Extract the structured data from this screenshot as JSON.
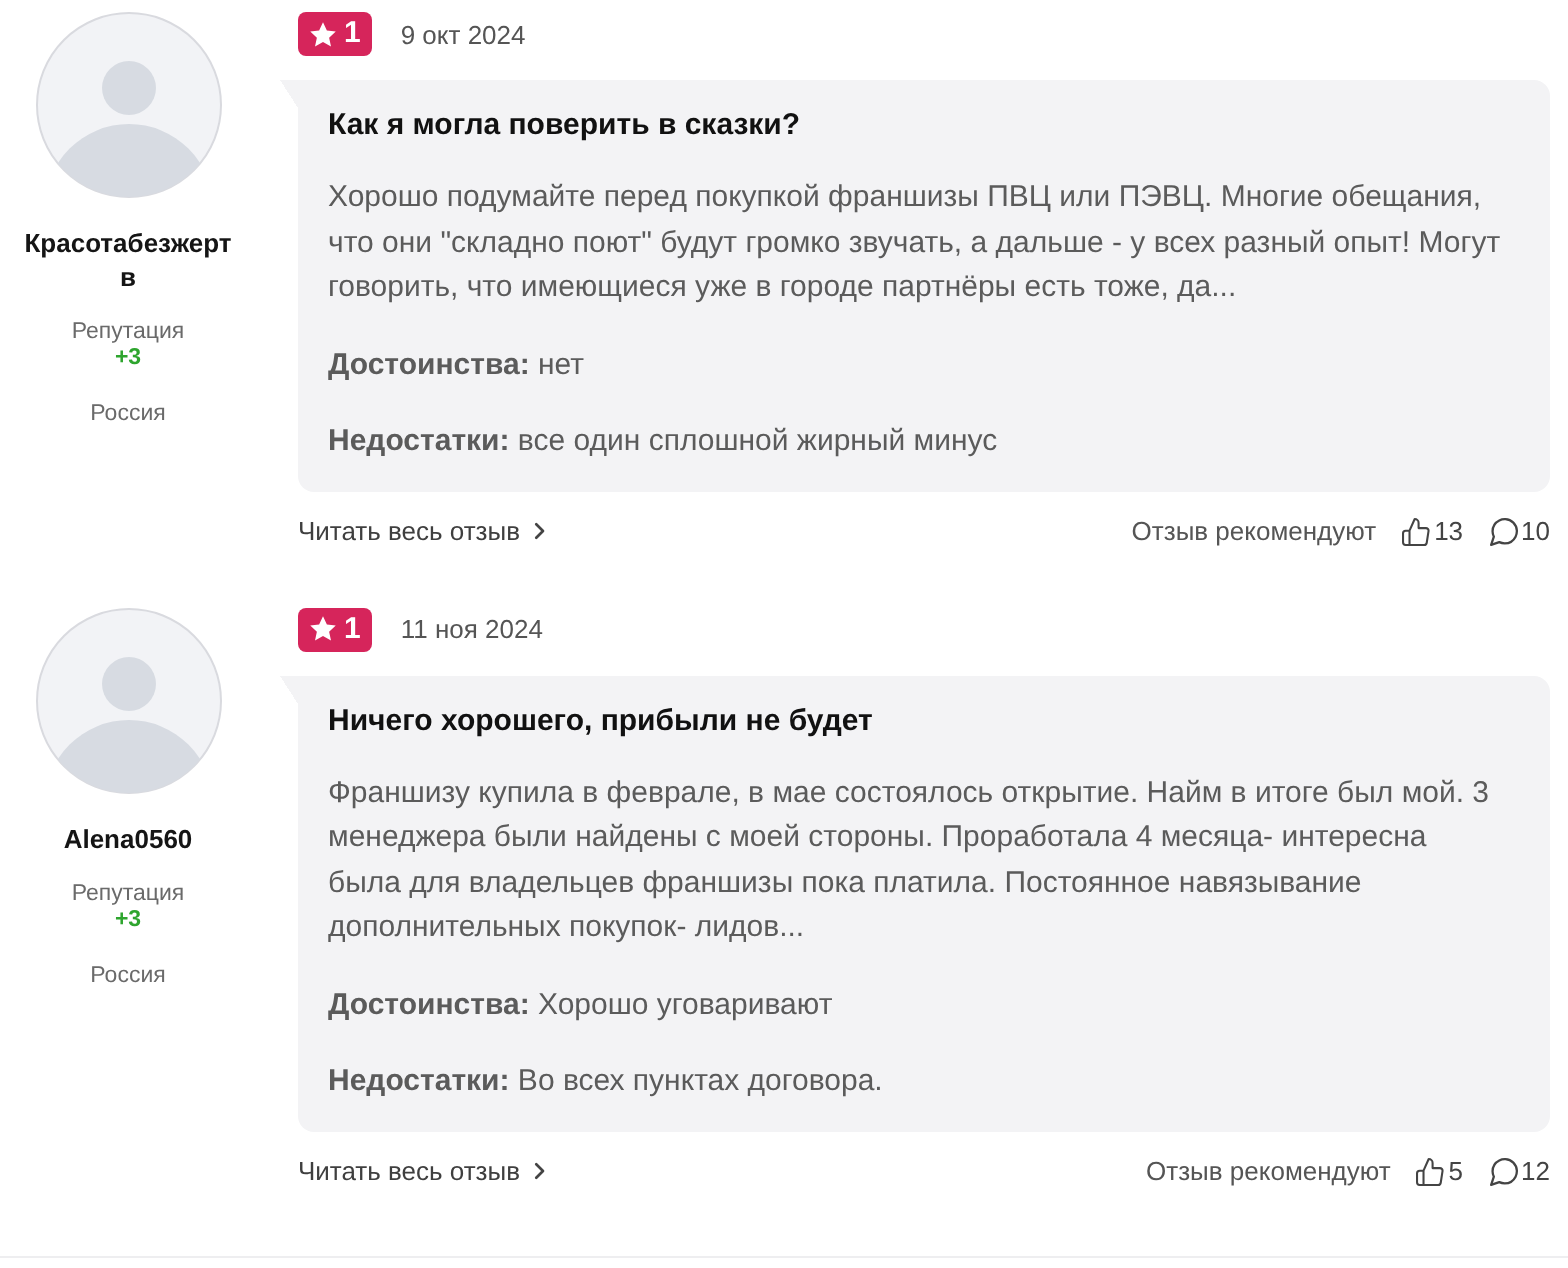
{
  "reviews": [
    {
      "author": {
        "name": "Красотабезжертв",
        "reputation_label": "Репутация",
        "reputation": "+3",
        "country": "Россия"
      },
      "rating": "1",
      "date": "9 окт 2024",
      "title": "Как я могла поверить в сказки?",
      "text": "Хорошо подумайте перед покупкой франшизы ПВЦ или ПЭВЦ. Многие обещания, что они \"складно поют\" будут громко звучать, а дальше - у всех разный опыт! Могут говорить, что имеющиеся уже в городе партнёры есть тоже, да...",
      "pros": "**Достоинства:** нет",
      "cons": "**Недостатки:** все один сплошной жирный минус",
      "read_more": "Читать весь отзыв",
      "recommend_label": "Отзыв рекомендуют",
      "likes": "13",
      "comments": "10"
    },
    {
      "author": {
        "name": "Alena0560",
        "reputation_label": "Репутация",
        "reputation": "+3",
        "country": "Россия"
      },
      "rating": "1",
      "date": "11 ноя 2024",
      "title": "Ничего хорошего, прибыли не будет",
      "text": "Франшизу купила в феврале, в мае состоялось открытие. Найм в итоге был мой. 3 менеджера были найдены с моей стороны. Проработала 4 месяца- интересна была для владельцев франшизы пока платила. Постоянное навязывание дополнительных покупок- лидов...",
      "pros": "**Достоинства:** Хорошо уговаривают",
      "cons": "**Недостатки:** Во всех пунктах договора.",
      "read_more": "Читать весь отзыв",
      "recommend_label": "Отзыв рекомендуют",
      "likes": "5",
      "comments": "12"
    }
  ]
}
